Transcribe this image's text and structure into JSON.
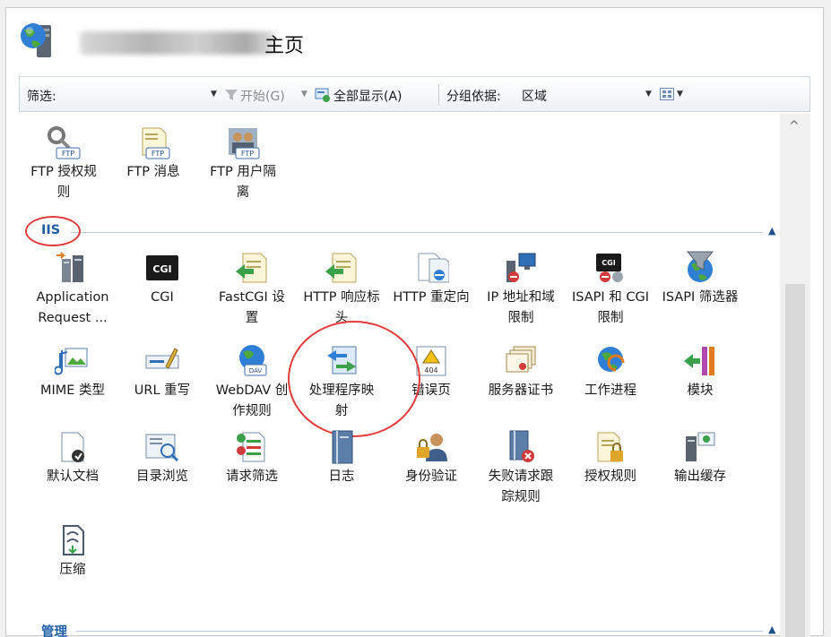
{
  "header": {
    "title": "主页"
  },
  "toolbar": {
    "filter_label": "筛选:",
    "start_label": "开始(G)",
    "show_all_label": "全部显示(A)",
    "group_by_label": "分组依据:",
    "group_by_value": "区域"
  },
  "categories": {
    "iis": "IIS",
    "manage": "管理"
  },
  "ftp_items": [
    {
      "label": "FTP 授权规\n则",
      "icon": "ftp-authorization-icon"
    },
    {
      "label": "FTP 消息",
      "icon": "ftp-messages-icon"
    },
    {
      "label": "FTP 用户隔\n离",
      "icon": "ftp-user-isolation-icon"
    }
  ],
  "iis_items": [
    {
      "label": "Application\nRequest ...",
      "icon": "application-request-routing-icon"
    },
    {
      "label": "CGI",
      "icon": "cgi-icon"
    },
    {
      "label": "FastCGI 设\n置",
      "icon": "fastcgi-icon"
    },
    {
      "label": "HTTP 响应标\n头",
      "icon": "http-response-headers-icon"
    },
    {
      "label": "HTTP 重定向",
      "icon": "http-redirect-icon"
    },
    {
      "label": "IP 地址和域\n限制",
      "icon": "ip-domain-restrictions-icon"
    },
    {
      "label": "ISAPI 和 CGI\n限制",
      "icon": "isapi-cgi-restrictions-icon"
    },
    {
      "label": "ISAPI 筛选器",
      "icon": "isapi-filters-icon"
    },
    {
      "label": "MIME 类型",
      "icon": "mime-types-icon"
    },
    {
      "label": "URL 重写",
      "icon": "url-rewrite-icon"
    },
    {
      "label": "WebDAV 创\n作规则",
      "icon": "webdav-icon"
    },
    {
      "label": "处理程序映\n射",
      "icon": "handler-mappings-icon"
    },
    {
      "label": "错误页",
      "icon": "error-pages-icon"
    },
    {
      "label": "服务器证书",
      "icon": "server-certificates-icon"
    },
    {
      "label": "工作进程",
      "icon": "worker-processes-icon"
    },
    {
      "label": "模块",
      "icon": "modules-icon"
    },
    {
      "label": "默认文档",
      "icon": "default-document-icon"
    },
    {
      "label": "目录浏览",
      "icon": "directory-browsing-icon"
    },
    {
      "label": "请求筛选",
      "icon": "request-filtering-icon"
    },
    {
      "label": "日志",
      "icon": "logging-icon"
    },
    {
      "label": "身份验证",
      "icon": "authentication-icon"
    },
    {
      "label": "失败请求跟\n踪规则",
      "icon": "failed-request-tracing-icon"
    },
    {
      "label": "授权规则",
      "icon": "authorization-rules-icon"
    },
    {
      "label": "输出缓存",
      "icon": "output-caching-icon"
    },
    {
      "label": "压缩",
      "icon": "compression-icon"
    }
  ],
  "icon_text": {
    "ftp": "FTP",
    "cgi": "CGI",
    "dav": "DAV",
    "err": "404"
  },
  "colors": {
    "annotation_red": "#e33b3b",
    "category_blue": "#1f5fa8"
  }
}
